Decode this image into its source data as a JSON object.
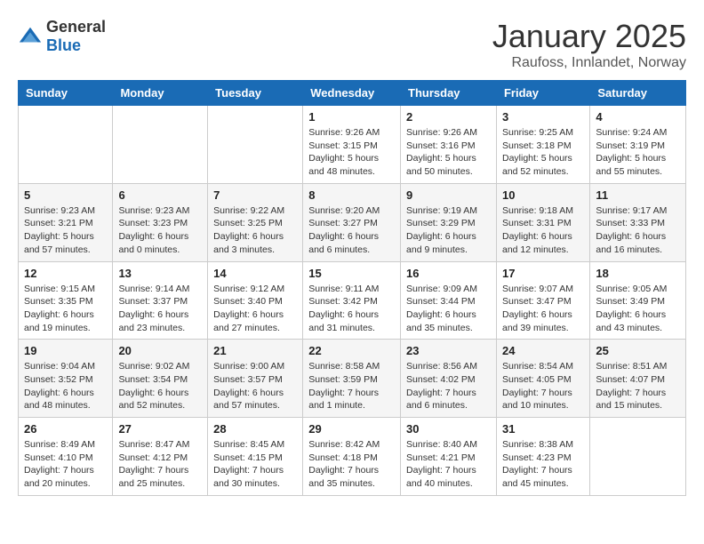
{
  "logo": {
    "general": "General",
    "blue": "Blue"
  },
  "title": "January 2025",
  "subtitle": "Raufoss, Innlandet, Norway",
  "days_of_week": [
    "Sunday",
    "Monday",
    "Tuesday",
    "Wednesday",
    "Thursday",
    "Friday",
    "Saturday"
  ],
  "weeks": [
    [
      {
        "day": "",
        "info": ""
      },
      {
        "day": "",
        "info": ""
      },
      {
        "day": "",
        "info": ""
      },
      {
        "day": "1",
        "info": "Sunrise: 9:26 AM\nSunset: 3:15 PM\nDaylight: 5 hours and 48 minutes."
      },
      {
        "day": "2",
        "info": "Sunrise: 9:26 AM\nSunset: 3:16 PM\nDaylight: 5 hours and 50 minutes."
      },
      {
        "day": "3",
        "info": "Sunrise: 9:25 AM\nSunset: 3:18 PM\nDaylight: 5 hours and 52 minutes."
      },
      {
        "day": "4",
        "info": "Sunrise: 9:24 AM\nSunset: 3:19 PM\nDaylight: 5 hours and 55 minutes."
      }
    ],
    [
      {
        "day": "5",
        "info": "Sunrise: 9:23 AM\nSunset: 3:21 PM\nDaylight: 5 hours and 57 minutes."
      },
      {
        "day": "6",
        "info": "Sunrise: 9:23 AM\nSunset: 3:23 PM\nDaylight: 6 hours and 0 minutes."
      },
      {
        "day": "7",
        "info": "Sunrise: 9:22 AM\nSunset: 3:25 PM\nDaylight: 6 hours and 3 minutes."
      },
      {
        "day": "8",
        "info": "Sunrise: 9:20 AM\nSunset: 3:27 PM\nDaylight: 6 hours and 6 minutes."
      },
      {
        "day": "9",
        "info": "Sunrise: 9:19 AM\nSunset: 3:29 PM\nDaylight: 6 hours and 9 minutes."
      },
      {
        "day": "10",
        "info": "Sunrise: 9:18 AM\nSunset: 3:31 PM\nDaylight: 6 hours and 12 minutes."
      },
      {
        "day": "11",
        "info": "Sunrise: 9:17 AM\nSunset: 3:33 PM\nDaylight: 6 hours and 16 minutes."
      }
    ],
    [
      {
        "day": "12",
        "info": "Sunrise: 9:15 AM\nSunset: 3:35 PM\nDaylight: 6 hours and 19 minutes."
      },
      {
        "day": "13",
        "info": "Sunrise: 9:14 AM\nSunset: 3:37 PM\nDaylight: 6 hours and 23 minutes."
      },
      {
        "day": "14",
        "info": "Sunrise: 9:12 AM\nSunset: 3:40 PM\nDaylight: 6 hours and 27 minutes."
      },
      {
        "day": "15",
        "info": "Sunrise: 9:11 AM\nSunset: 3:42 PM\nDaylight: 6 hours and 31 minutes."
      },
      {
        "day": "16",
        "info": "Sunrise: 9:09 AM\nSunset: 3:44 PM\nDaylight: 6 hours and 35 minutes."
      },
      {
        "day": "17",
        "info": "Sunrise: 9:07 AM\nSunset: 3:47 PM\nDaylight: 6 hours and 39 minutes."
      },
      {
        "day": "18",
        "info": "Sunrise: 9:05 AM\nSunset: 3:49 PM\nDaylight: 6 hours and 43 minutes."
      }
    ],
    [
      {
        "day": "19",
        "info": "Sunrise: 9:04 AM\nSunset: 3:52 PM\nDaylight: 6 hours and 48 minutes."
      },
      {
        "day": "20",
        "info": "Sunrise: 9:02 AM\nSunset: 3:54 PM\nDaylight: 6 hours and 52 minutes."
      },
      {
        "day": "21",
        "info": "Sunrise: 9:00 AM\nSunset: 3:57 PM\nDaylight: 6 hours and 57 minutes."
      },
      {
        "day": "22",
        "info": "Sunrise: 8:58 AM\nSunset: 3:59 PM\nDaylight: 7 hours and 1 minute."
      },
      {
        "day": "23",
        "info": "Sunrise: 8:56 AM\nSunset: 4:02 PM\nDaylight: 7 hours and 6 minutes."
      },
      {
        "day": "24",
        "info": "Sunrise: 8:54 AM\nSunset: 4:05 PM\nDaylight: 7 hours and 10 minutes."
      },
      {
        "day": "25",
        "info": "Sunrise: 8:51 AM\nSunset: 4:07 PM\nDaylight: 7 hours and 15 minutes."
      }
    ],
    [
      {
        "day": "26",
        "info": "Sunrise: 8:49 AM\nSunset: 4:10 PM\nDaylight: 7 hours and 20 minutes."
      },
      {
        "day": "27",
        "info": "Sunrise: 8:47 AM\nSunset: 4:12 PM\nDaylight: 7 hours and 25 minutes."
      },
      {
        "day": "28",
        "info": "Sunrise: 8:45 AM\nSunset: 4:15 PM\nDaylight: 7 hours and 30 minutes."
      },
      {
        "day": "29",
        "info": "Sunrise: 8:42 AM\nSunset: 4:18 PM\nDaylight: 7 hours and 35 minutes."
      },
      {
        "day": "30",
        "info": "Sunrise: 8:40 AM\nSunset: 4:21 PM\nDaylight: 7 hours and 40 minutes."
      },
      {
        "day": "31",
        "info": "Sunrise: 8:38 AM\nSunset: 4:23 PM\nDaylight: 7 hours and 45 minutes."
      },
      {
        "day": "",
        "info": ""
      }
    ]
  ]
}
